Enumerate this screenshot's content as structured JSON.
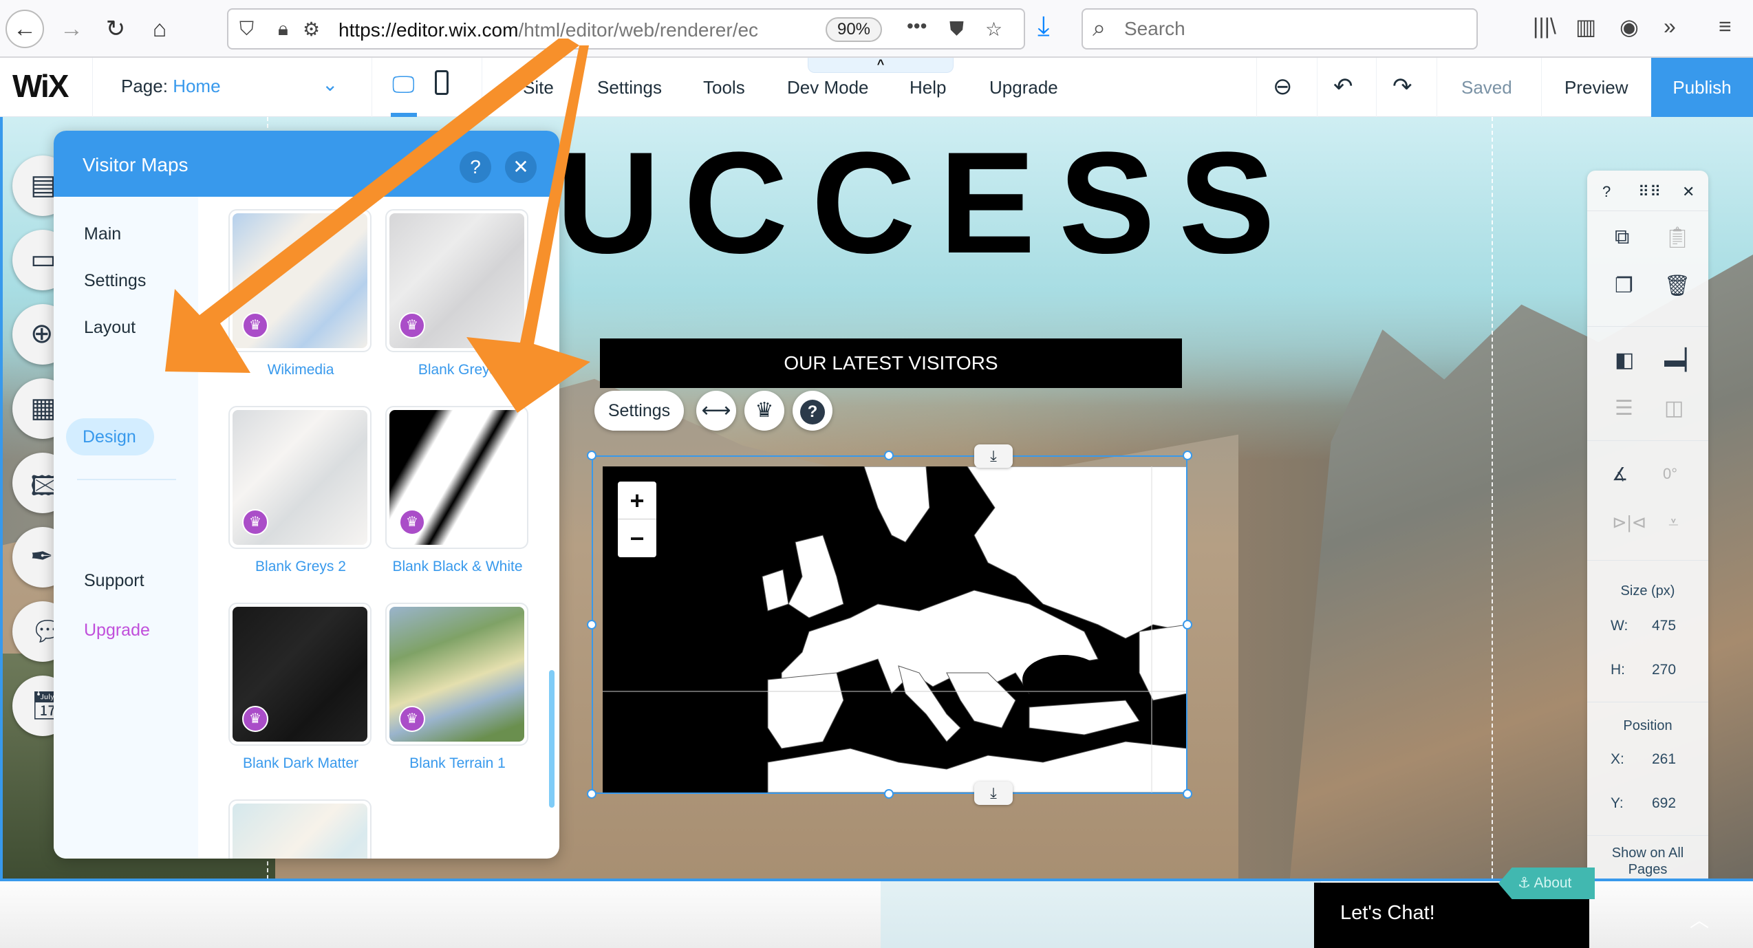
{
  "browser": {
    "url_host": "https://editor.wix.com",
    "url_path": "/html/editor/web/renderer/ec",
    "zoom_level": "90%",
    "search_placeholder": "Search",
    "icons": [
      "back-icon",
      "forward-icon",
      "reload-icon",
      "home-icon",
      "tracking-protection-icon",
      "lock-icon",
      "permissions-icon",
      "more-icon",
      "pocket-icon",
      "bookmark-star-icon",
      "download-icon",
      "search-icon",
      "library-icon",
      "sidebar-icon",
      "account-icon",
      "overflow-icon",
      "menu-icon"
    ]
  },
  "wix_toolbar": {
    "logo": "WiX",
    "page_label": "Page:",
    "page_name": "Home",
    "menu": [
      "Site",
      "Settings",
      "Tools",
      "Dev Mode",
      "Help",
      "Upgrade"
    ],
    "status": "Saved",
    "preview_label": "Preview",
    "publish_label": "Publish",
    "collapse_glyph": "^"
  },
  "left_rail": {
    "items": [
      "menus-pages",
      "background",
      "add",
      "add-apps",
      "media",
      "blog",
      "chat",
      "bookings"
    ]
  },
  "visitor_maps_panel": {
    "title": "Visitor Maps",
    "help_glyph": "?",
    "close_glyph": "✕",
    "nav": [
      "Main",
      "Settings",
      "Layout",
      "Design",
      "Support",
      "Upgrade"
    ],
    "active_nav": "Design",
    "themes": [
      {
        "label": "Wikimedia",
        "premium": true
      },
      {
        "label": "Blank Greys",
        "premium": true
      },
      {
        "label": "Blank Greys 2",
        "premium": true
      },
      {
        "label": "Blank Black & White",
        "premium": true
      },
      {
        "label": "Blank Dark Matter",
        "premium": true
      },
      {
        "label": "Blank Terrain 1",
        "premium": true
      },
      {
        "label": "",
        "premium": false
      }
    ]
  },
  "page_content": {
    "heading": "UCCESS",
    "banner": "OUR LATEST VISITORS",
    "element_toolbar": {
      "settings_label": "Settings",
      "icons": [
        "stretch-icon",
        "upgrade-crown-icon",
        "help-icon"
      ]
    },
    "map": {
      "zoom_in": "+",
      "zoom_out": "−"
    },
    "chat_label": "Let's Chat!",
    "anchor_label": "About"
  },
  "properties_panel": {
    "help_glyph": "?",
    "close_glyph": "✕",
    "rotation": "0°",
    "size_title": "Size (px)",
    "width_label": "W:",
    "width_value": "475",
    "height_label": "H:",
    "height_value": "270",
    "position_title": "Position",
    "x_label": "X:",
    "x_value": "261",
    "y_label": "Y:",
    "y_value": "692",
    "show_all_pages_label": "Show on All Pages",
    "show_all_pages_on": false
  },
  "colors": {
    "wix_blue": "#3899ec",
    "premium_purple": "#aa4dc8",
    "upgrade_purple": "#c04fdb",
    "annotation_orange": "#f7902b"
  }
}
